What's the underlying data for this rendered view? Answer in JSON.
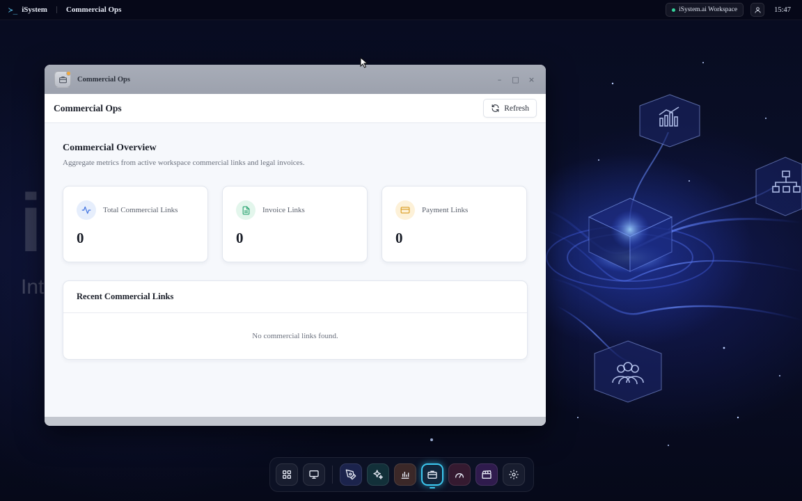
{
  "topbar": {
    "logo_glyph": "≻_",
    "brand": "iSystem",
    "active_app": "Commercial Ops",
    "workspace": "iSystem.ai Workspace",
    "user_icon": "user-icon",
    "clock": "15:47"
  },
  "desktop": {
    "brand_text": "i",
    "tagline_text": "Int"
  },
  "window": {
    "title": "Commercial Ops",
    "app_icon": "briefcase-icon",
    "controls": {
      "minimize": "–",
      "maximize": "□",
      "close": "×"
    }
  },
  "app": {
    "header_title": "Commercial Ops",
    "refresh_label": "Refresh",
    "overview": {
      "title": "Commercial Overview",
      "subtitle": "Aggregate metrics from active workspace commercial links and legal invoices."
    },
    "stats": [
      {
        "label": "Total Commercial Links",
        "value": "0",
        "icon": "activity-icon",
        "color": "#3b6fe0",
        "bg": "#e6eefc"
      },
      {
        "label": "Invoice Links",
        "value": "0",
        "icon": "document-icon",
        "color": "#22a06b",
        "bg": "#e3f6ec"
      },
      {
        "label": "Payment Links",
        "value": "0",
        "icon": "credit-card-icon",
        "color": "#d99a1e",
        "bg": "#fdf1d8"
      }
    ],
    "recent": {
      "title": "Recent Commercial Links",
      "empty_text": "No commercial links found."
    }
  },
  "dock": {
    "items": [
      {
        "name": "apps-grid-icon"
      },
      {
        "name": "monitor-icon"
      },
      {
        "name": "pen-tool-icon"
      },
      {
        "name": "sparkles-icon"
      },
      {
        "name": "bar-chart-icon"
      },
      {
        "name": "briefcase-icon",
        "active": true
      },
      {
        "name": "gauge-icon"
      },
      {
        "name": "clapperboard-icon"
      },
      {
        "name": "settings-icon"
      }
    ]
  },
  "colors": {
    "accent": "#3cc8f0",
    "desktop_bg": "#070b1d",
    "status_online": "#35d39b"
  }
}
